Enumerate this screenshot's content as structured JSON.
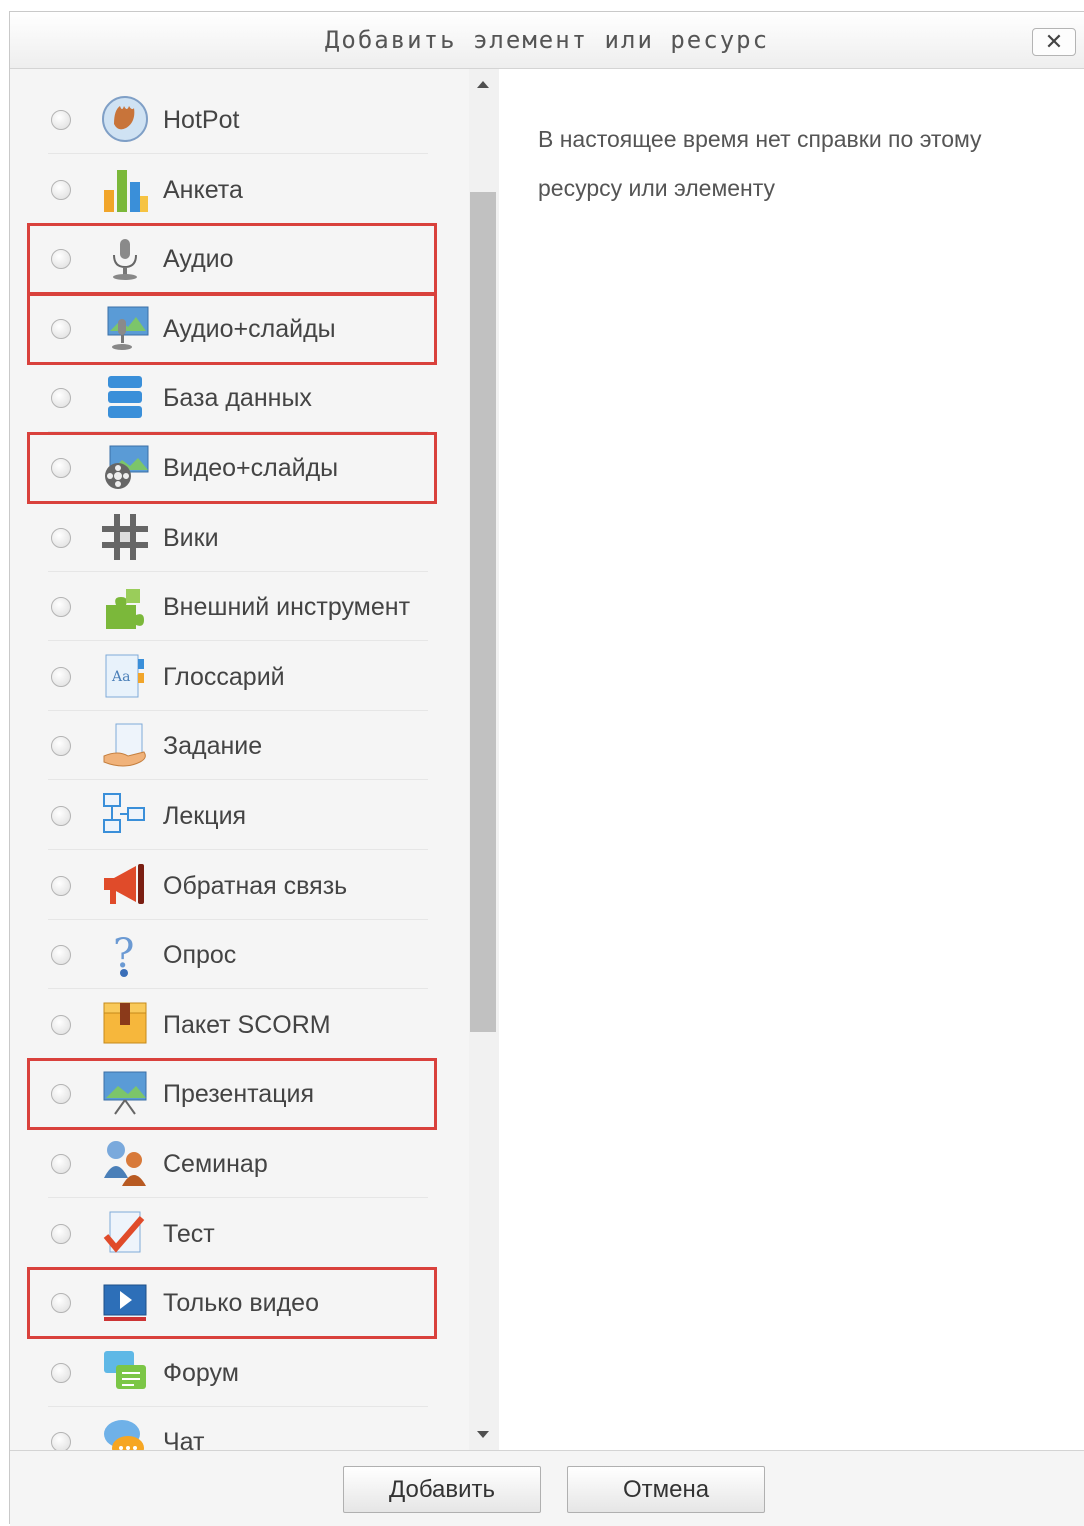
{
  "dialog": {
    "title": "Добавить элемент или ресурс",
    "close_label": "✕"
  },
  "items": [
    {
      "label": "HotPot",
      "icon": "hotpot-hand-icon",
      "highlighted": false
    },
    {
      "label": "Анкета",
      "icon": "survey-bar-chart-icon",
      "highlighted": false
    },
    {
      "label": "Аудио",
      "icon": "microphone-icon",
      "highlighted": true
    },
    {
      "label": "Аудио+слайды",
      "icon": "microphone-slide-icon",
      "highlighted": true
    },
    {
      "label": "База данных",
      "icon": "database-icon",
      "highlighted": false
    },
    {
      "label": "Видео+слайды",
      "icon": "film-reel-slide-icon",
      "highlighted": true
    },
    {
      "label": "Вики",
      "icon": "wiki-hash-icon",
      "highlighted": false
    },
    {
      "label": "Внешний инструмент",
      "icon": "puzzle-piece-icon",
      "highlighted": false
    },
    {
      "label": "Глоссарий",
      "icon": "glossary-book-icon",
      "highlighted": false
    },
    {
      "label": "Задание",
      "icon": "assignment-hand-icon",
      "highlighted": false
    },
    {
      "label": "Лекция",
      "icon": "lesson-flowchart-icon",
      "highlighted": false
    },
    {
      "label": "Обратная связь",
      "icon": "megaphone-icon",
      "highlighted": false
    },
    {
      "label": "Опрос",
      "icon": "question-mark-icon",
      "highlighted": false
    },
    {
      "label": "Пакет SCORM",
      "icon": "scorm-package-icon",
      "highlighted": false
    },
    {
      "label": "Презентация",
      "icon": "presentation-screen-icon",
      "highlighted": true
    },
    {
      "label": "Семинар",
      "icon": "workshop-people-icon",
      "highlighted": false
    },
    {
      "label": "Тест",
      "icon": "quiz-checkmark-icon",
      "highlighted": false
    },
    {
      "label": "Только видео",
      "icon": "video-play-icon",
      "highlighted": true
    },
    {
      "label": "Форум",
      "icon": "forum-bubbles-icon",
      "highlighted": false
    },
    {
      "label": "Чат",
      "icon": "chat-bubble-icon",
      "highlighted": false
    }
  ],
  "help": {
    "text": "В настоящее время нет справки по этому ресурсу или элементу"
  },
  "footer": {
    "add_label": "Добавить",
    "cancel_label": "Отмена"
  },
  "colors": {
    "highlight": "#d9413c"
  }
}
